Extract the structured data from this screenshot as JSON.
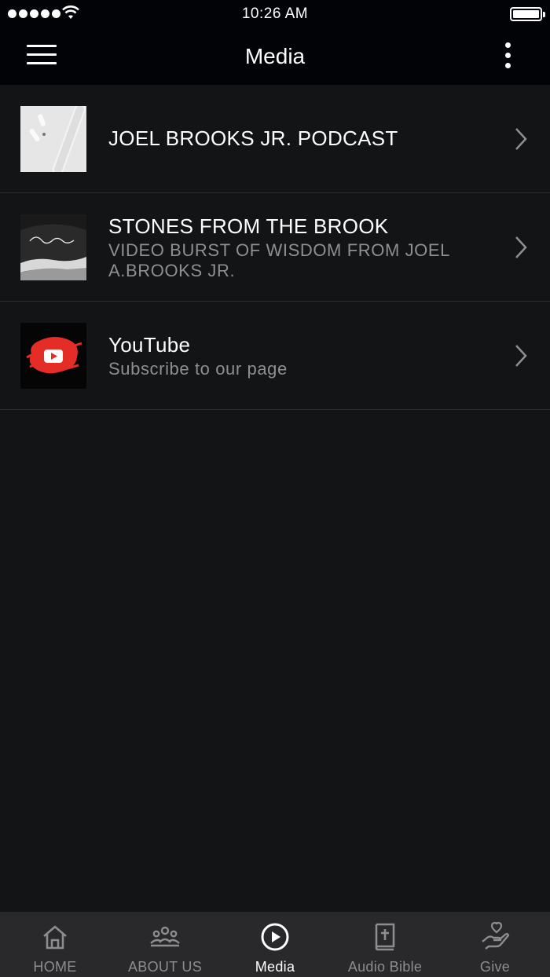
{
  "status_bar": {
    "time": "10:26 AM"
  },
  "nav": {
    "title": "Media"
  },
  "items": [
    {
      "title": "JOEL BROOKS JR. PODCAST",
      "subtitle": ""
    },
    {
      "title": "STONES FROM THE BROOK",
      "subtitle": "VIDEO BURST OF WISDOM FROM JOEL A.BROOKS JR."
    },
    {
      "title": "YouTube",
      "subtitle": "Subscribe to our page"
    }
  ],
  "tabs": [
    {
      "label": "HOME",
      "icon": "home-icon",
      "active": false
    },
    {
      "label": "ABOUT US",
      "icon": "people-group-icon",
      "active": false
    },
    {
      "label": "Media",
      "icon": "play-circle-icon",
      "active": true
    },
    {
      "label": "Audio Bible",
      "icon": "bible-icon",
      "active": false
    },
    {
      "label": "Give",
      "icon": "hand-heart-icon",
      "active": false
    }
  ],
  "colors": {
    "background": "#131416",
    "header": "#020306",
    "tab_bar": "#29292b",
    "muted_text": "#8e8f93",
    "youtube_red": "#e52d27"
  }
}
